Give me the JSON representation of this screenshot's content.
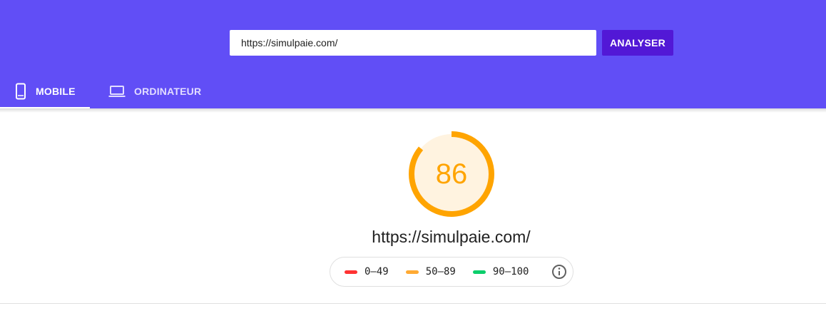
{
  "search": {
    "url_value": "https://simulpaie.com/",
    "analyze_label": "ANALYSER"
  },
  "tabs": [
    {
      "label": "MOBILE",
      "icon": "smartphone-icon",
      "selected": true
    },
    {
      "label": "ORDINATEUR",
      "icon": "laptop-icon",
      "selected": false
    }
  ],
  "report": {
    "score": "86",
    "score_fraction": 0.86,
    "tested_url": "https://simulpaie.com/"
  },
  "legend": {
    "items": [
      {
        "label": "0–49",
        "color": "#ff3333"
      },
      {
        "label": "50–89",
        "color": "#ffaa33"
      },
      {
        "label": "90–100",
        "color": "#0cce6b"
      }
    ],
    "info_icon": "info-icon"
  },
  "colors": {
    "header": "#614ef6",
    "button": "#5218d6",
    "score_average": "#ffa400",
    "gauge_fill": "#fff3e0"
  }
}
